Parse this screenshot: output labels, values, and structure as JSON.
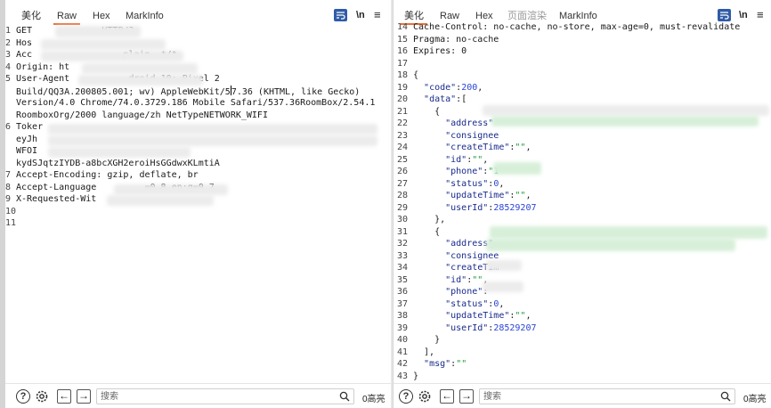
{
  "request_pane": {
    "tabs": [
      "美化",
      "Raw",
      "Hex",
      "MarkInfo"
    ],
    "active_tab": "Raw",
    "toolbar": {
      "newline_label": "\\n",
      "menu_label": "≡",
      "wrap_icon": "wrap-lines-icon"
    },
    "lines": [
      {
        "n": "1",
        "text": "GET",
        "tail": "HTTP/2"
      },
      {
        "n": "2",
        "text": "Hos"
      },
      {
        "n": "3",
        "text": "Acc",
        "tail": "plain, */*"
      },
      {
        "n": "4",
        "text": "Origin: ht"
      },
      {
        "n": "5",
        "text": "User-Agent",
        "tail": "droid 10; Pixel 2"
      },
      {
        "n": "",
        "text": "Build/QQ3A.200805.001; wv) AppleWebKit/5",
        "tail": "7.36 (KHTML, like Gecko)"
      },
      {
        "n": "",
        "text": "Version/4.0 Chrome/74.0.3729.186 Mobile Safari/537.36RoomBox/2.54.1"
      },
      {
        "n": "",
        "text": "RoomboxOrg/2000 language/zh NetTypeNETWORK_WIFI"
      },
      {
        "n": "6",
        "text": "Toker"
      },
      {
        "n": "",
        "text": "eyJh"
      },
      {
        "n": "",
        "text": "WFOI"
      },
      {
        "n": "",
        "text": "kydSJqtzIYDB-a8bcXGH2eroiHsGGdwxKLmtiA"
      },
      {
        "n": "7",
        "text": "Accept-Encoding: gzip, deflate, br"
      },
      {
        "n": "8",
        "text": "Accept-Language",
        "tail": "=0.8,en;q=0.7"
      },
      {
        "n": "9",
        "text": "X-Requested-Wit"
      },
      {
        "n": "10",
        "text": ""
      },
      {
        "n": "11",
        "text": ""
      }
    ],
    "footer": {
      "search_placeholder": "搜索",
      "hits": "0高亮"
    }
  },
  "response_pane": {
    "tabs": [
      "美化",
      "Raw",
      "Hex",
      "页面渲染",
      "MarkInfo"
    ],
    "active_tab": "美化",
    "toolbar": {
      "newline_label": "\\n",
      "menu_label": "≡",
      "wrap_icon": "wrap-lines-icon"
    },
    "lines": [
      {
        "n": "14",
        "parts": [
          [
            "t",
            "Cache-Control: no-cache, no-store, max-age=0, must-revalidate"
          ]
        ]
      },
      {
        "n": "15",
        "parts": [
          [
            "t",
            "Pragma: no-cache"
          ]
        ]
      },
      {
        "n": "16",
        "parts": [
          [
            "t",
            "Expires: 0"
          ]
        ]
      },
      {
        "n": "17",
        "parts": []
      },
      {
        "n": "18",
        "parts": [
          [
            "t",
            "{"
          ]
        ]
      },
      {
        "n": "19",
        "parts": [
          [
            "t",
            "  "
          ],
          [
            "k",
            "\"code\""
          ],
          [
            "t",
            ":"
          ],
          [
            "v",
            "200"
          ],
          [
            "t",
            ","
          ]
        ]
      },
      {
        "n": "20",
        "parts": [
          [
            "t",
            "  "
          ],
          [
            "k",
            "\"data\""
          ],
          [
            "t",
            ":["
          ]
        ]
      },
      {
        "n": "21",
        "parts": [
          [
            "t",
            "    {"
          ]
        ]
      },
      {
        "n": "22",
        "parts": [
          [
            "t",
            "      "
          ],
          [
            "k",
            "\"address\""
          ]
        ]
      },
      {
        "n": "23",
        "parts": [
          [
            "t",
            "      "
          ],
          [
            "k",
            "\"consignee"
          ]
        ]
      },
      {
        "n": "24",
        "parts": [
          [
            "t",
            "      "
          ],
          [
            "k",
            "\"createTime\""
          ],
          [
            "t",
            ":"
          ],
          [
            "s",
            "\"\""
          ],
          [
            "t",
            ","
          ]
        ]
      },
      {
        "n": "25",
        "parts": [
          [
            "t",
            "      "
          ],
          [
            "k",
            "\"id\""
          ],
          [
            "t",
            ":"
          ],
          [
            "s",
            "\"\""
          ],
          [
            "t",
            ","
          ]
        ]
      },
      {
        "n": "26",
        "parts": [
          [
            "t",
            "      "
          ],
          [
            "k",
            "\"phone\""
          ],
          [
            "t",
            ":"
          ],
          [
            "s",
            "\"1"
          ]
        ]
      },
      {
        "n": "27",
        "parts": [
          [
            "t",
            "      "
          ],
          [
            "k",
            "\"status\""
          ],
          [
            "t",
            ":"
          ],
          [
            "v",
            "0"
          ],
          [
            "t",
            ","
          ]
        ]
      },
      {
        "n": "28",
        "parts": [
          [
            "t",
            "      "
          ],
          [
            "k",
            "\"updateTime\""
          ],
          [
            "t",
            ":"
          ],
          [
            "s",
            "\"\""
          ],
          [
            "t",
            ","
          ]
        ]
      },
      {
        "n": "29",
        "parts": [
          [
            "t",
            "      "
          ],
          [
            "k",
            "\"userId\""
          ],
          [
            "t",
            ":"
          ],
          [
            "v",
            "28529207"
          ]
        ]
      },
      {
        "n": "30",
        "parts": [
          [
            "t",
            "    },"
          ]
        ]
      },
      {
        "n": "31",
        "parts": [
          [
            "t",
            "    {"
          ]
        ]
      },
      {
        "n": "32",
        "parts": [
          [
            "t",
            "      "
          ],
          [
            "k",
            "\"address\""
          ]
        ]
      },
      {
        "n": "33",
        "parts": [
          [
            "t",
            "      "
          ],
          [
            "k",
            "\"consignee"
          ]
        ]
      },
      {
        "n": "34",
        "parts": [
          [
            "t",
            "      "
          ],
          [
            "k",
            "\"createTim"
          ]
        ]
      },
      {
        "n": "35",
        "parts": [
          [
            "t",
            "      "
          ],
          [
            "k",
            "\"id\""
          ],
          [
            "t",
            ":"
          ],
          [
            "s",
            "\"\""
          ],
          [
            "t",
            ","
          ]
        ]
      },
      {
        "n": "36",
        "parts": [
          [
            "t",
            "      "
          ],
          [
            "k",
            "\"phone\""
          ],
          [
            "t",
            ":"
          ]
        ]
      },
      {
        "n": "37",
        "parts": [
          [
            "t",
            "      "
          ],
          [
            "k",
            "\"status\""
          ],
          [
            "t",
            ":"
          ],
          [
            "v",
            "0"
          ],
          [
            "t",
            ","
          ]
        ]
      },
      {
        "n": "38",
        "parts": [
          [
            "t",
            "      "
          ],
          [
            "k",
            "\"updateTime\""
          ],
          [
            "t",
            ":"
          ],
          [
            "s",
            "\"\""
          ],
          [
            "t",
            ","
          ]
        ]
      },
      {
        "n": "39",
        "parts": [
          [
            "t",
            "      "
          ],
          [
            "k",
            "\"userId\""
          ],
          [
            "t",
            ":"
          ],
          [
            "v",
            "28529207"
          ]
        ]
      },
      {
        "n": "40",
        "parts": [
          [
            "t",
            "    }"
          ]
        ]
      },
      {
        "n": "41",
        "parts": [
          [
            "t",
            "  ],"
          ]
        ]
      },
      {
        "n": "42",
        "parts": [
          [
            "t",
            "  "
          ],
          [
            "k",
            "\"msg\""
          ],
          [
            "t",
            ":"
          ],
          [
            "s",
            "\"\""
          ]
        ]
      },
      {
        "n": "43",
        "parts": [
          [
            "t",
            "}"
          ]
        ]
      }
    ],
    "footer": {
      "search_placeholder": "搜索",
      "hits": "0高亮"
    }
  },
  "colors": {
    "accent_underline": "#e8703a",
    "wrap_button": "#2f5ba8",
    "json_key": "#1a2b8c",
    "json_number": "#2a45d6",
    "json_string": "#1a9a39"
  }
}
